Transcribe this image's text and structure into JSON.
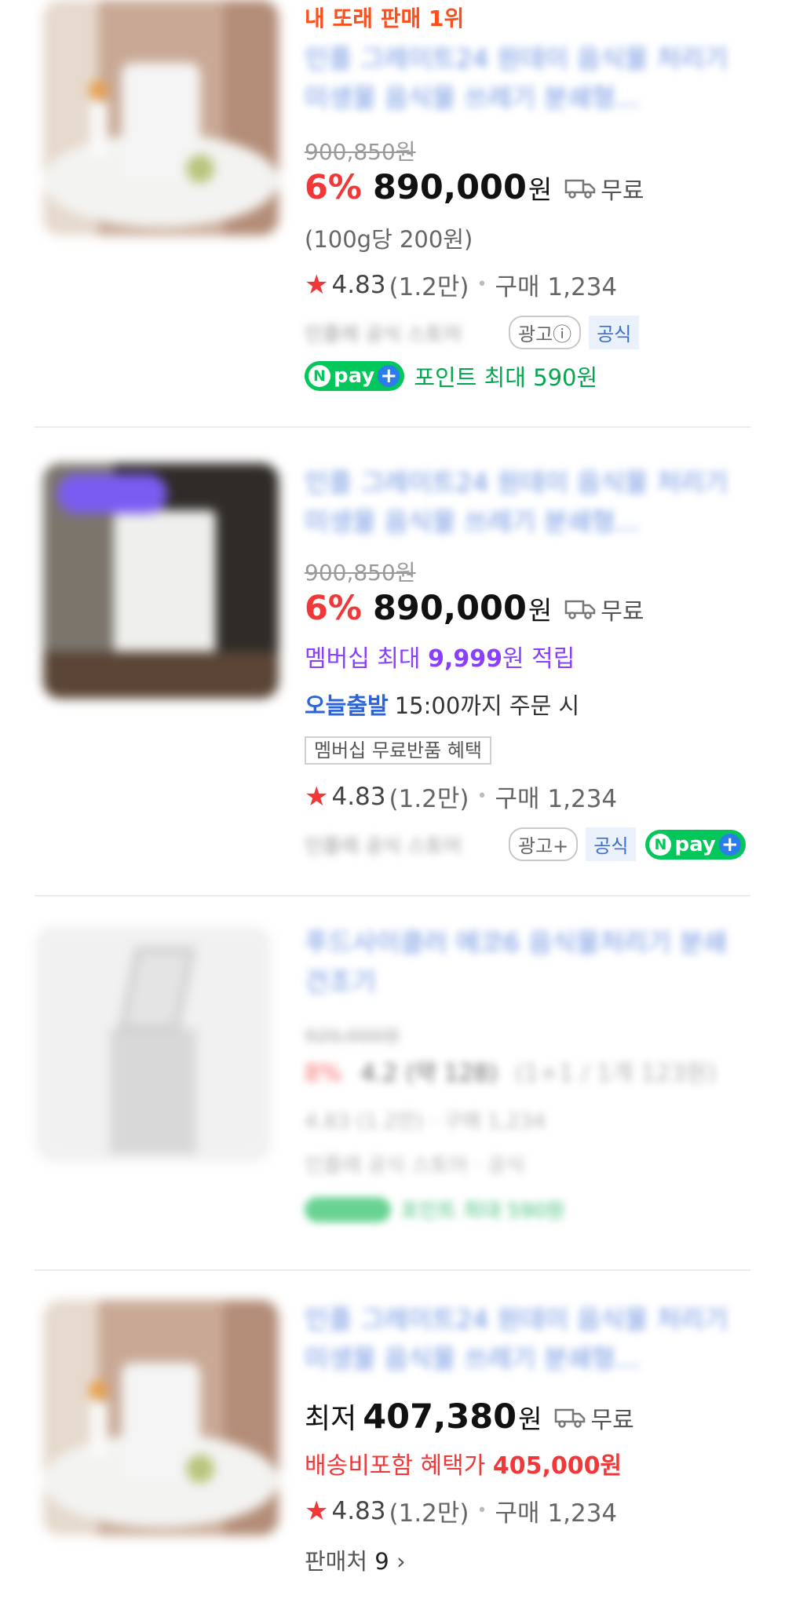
{
  "colors": {
    "accent": "#f03838",
    "naver_green": "#03c75a",
    "link_blue": "#3d6fd8",
    "membership_purple": "#8a3ffc"
  },
  "items": [
    {
      "rank_badge": "내 또래 판매 1위",
      "title": "인플 그레이트24 원데이 음식물 처리기 미생물 음식물 쓰레기 분쇄형...",
      "original_price": "900,850원",
      "discount": "6%",
      "price": "890,000",
      "won": "원",
      "shipping": "무료",
      "unit_price": "(100g당 200원)",
      "rating": "4.83",
      "review_count": "(1.2만)",
      "purchase": "구매 1,234",
      "seller": "인플레 공식 스토어",
      "ad_label": "광고ⓘ",
      "official_label": "공식",
      "npay": {
        "n": "N",
        "text": "pay",
        "plus": "+"
      },
      "points": "포인트 최대 590원"
    },
    {
      "title": "인플 그레이트24 원데이 음식물 처리기 미생물 음식물 쓰레기 분쇄형...",
      "original_price": "900,850원",
      "discount": "6%",
      "price": "890,000",
      "won": "원",
      "shipping": "무료",
      "membership_prefix": "멤버십 최대 ",
      "membership_amount": "9,999",
      "membership_suffix": "원 적립",
      "dispatch_label": "오늘출발",
      "dispatch_text": "15:00까지 주문 시",
      "return_badge": "멤버십 무료반품 혜택",
      "rating": "4.83",
      "review_count": "(1.2만)",
      "purchase": "구매 1,234",
      "seller": "인플레 공식 스토어",
      "ad_label": "광고+",
      "official_label": "공식",
      "npay": {
        "n": "N",
        "text": "pay",
        "plus": "+"
      }
    },
    {
      "title": "푸드사이클러 에코6 음식물처리기 분쇄 건조기",
      "original_price": "920,000원",
      "discount": "8%",
      "price": "4.2 (약 128)",
      "extra": "(1+1 / 1개 123원)",
      "rating": "4.83 (1.2만) · 구매 1,234",
      "seller": "인플레 공식 스토어 · 공식",
      "points": "포인트 최대 590원"
    },
    {
      "title": "인플 그레이트24 원데이 음식물 처리기 미생물 음식물 쓰레기 분쇄형...",
      "lowest_label": "최저",
      "price": "407,380",
      "won": "원",
      "shipping": "무료",
      "benefit_prefix": "배송비포함 혜택가 ",
      "benefit_amount": "405,000원",
      "rating": "4.83",
      "review_count": "(1.2만)",
      "purchase": "구매 1,234",
      "sellers_label": "판매처",
      "sellers_count": "9",
      "chevron": "›"
    }
  ]
}
